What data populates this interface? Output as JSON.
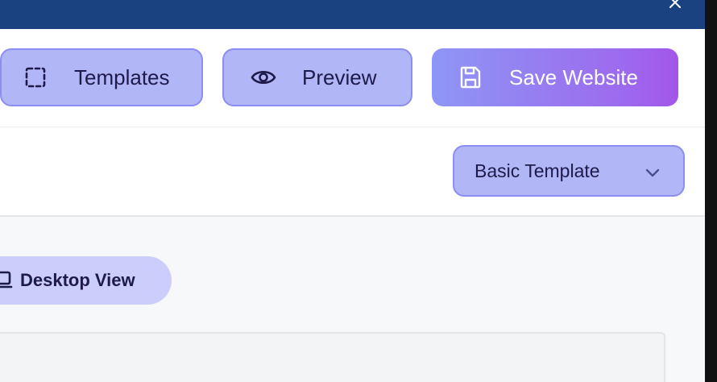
{
  "titlebar": {
    "close_icon": "close-icon",
    "color": "#1a4280"
  },
  "toolbar": {
    "templates": {
      "label": "Templates",
      "icon": "dashed-square-icon"
    },
    "preview": {
      "label": "Preview",
      "icon": "eye-icon"
    },
    "save": {
      "label": "Save Website",
      "icon": "save-icon"
    }
  },
  "template_select": {
    "value": "Basic Template",
    "icon": "chevron-down-icon"
  },
  "view_toggle": {
    "label": "Desktop View",
    "icon": "laptop-icon"
  },
  "colors": {
    "accent": "#b1b6f7",
    "accent_border": "#8b8ef0",
    "save_gradient_start": "#8e96f5",
    "save_gradient_end": "#a356ea",
    "text_dark": "#1e1b4b"
  }
}
